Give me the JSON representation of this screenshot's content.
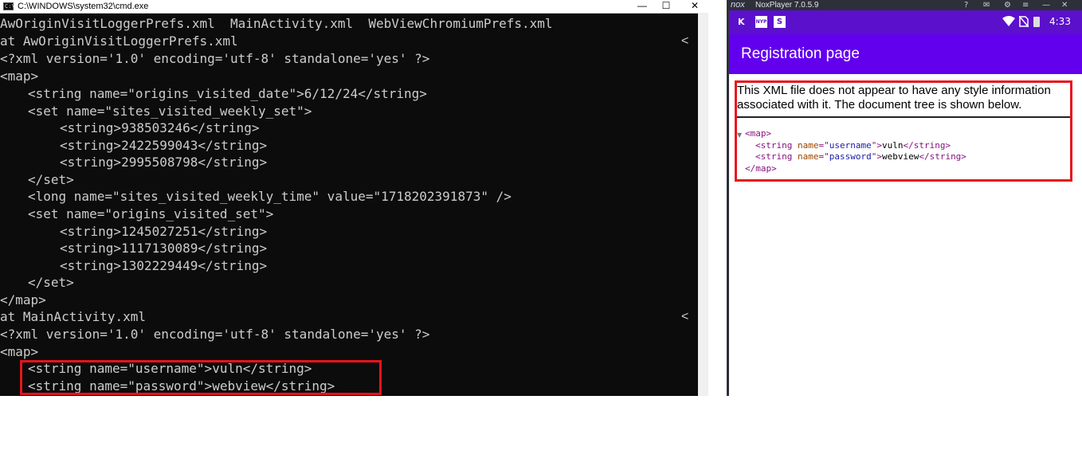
{
  "cmd": {
    "title": "C:\\WINDOWS\\system32\\cmd.exe",
    "controls": {
      "minimize": "—",
      "maximize": "☐",
      "close": "✕"
    },
    "lines": [
      "AwOriginVisitLoggerPrefs.xml  MainActivity.xml  WebViewChromiumPrefs.xml",
      "at AwOriginVisitLoggerPrefs.xml",
      "<?xml version='1.0' encoding='utf-8' standalone='yes' ?>",
      "<map>",
      "<string name=\"origins_visited_date\">6/12/24</string>",
      "<set name=\"sites_visited_weekly_set\">",
      "<string>938503246</string>",
      "<string>2422599043</string>",
      "<string>2995508798</string>",
      "</set>",
      "<long name=\"sites_visited_weekly_time\" value=\"1718202391873\" />",
      "<set name=\"origins_visited_set\">",
      "<string>1245027251</string>",
      "<string>1117130089</string>",
      "<string>1302229449</string>",
      "</set>",
      "</map>",
      "at MainActivity.xml",
      "<?xml version='1.0' encoding='utf-8' standalone='yes' ?>",
      "<map>",
      "<string name=\"username\">vuln</string>",
      "<string name=\"password\">webview</string>"
    ],
    "caret": "<"
  },
  "nox": {
    "logo": "nox",
    "title": "NoxPlayer 7.0.5.9",
    "icons": [
      "help-icon",
      "mail-icon",
      "settings-icon",
      "menu-icon",
      "minimize-icon",
      "close-icon"
    ],
    "status_bar": {
      "time": "4:33",
      "nyp": "NYP",
      "s": "S"
    },
    "app_title": "Registration page",
    "info_text": "This XML file does not appear to have any style information associated with it. The document tree is shown below.",
    "xml": {
      "map_open": "<map>",
      "username_attr": "username",
      "username_value": "vuln",
      "password_attr": "password",
      "password_value": "webview",
      "map_close": "</map>"
    },
    "colors": {
      "status_bar": "#5b10cc",
      "app_bar": "#6200ee",
      "highlight": "#e8141b"
    }
  }
}
